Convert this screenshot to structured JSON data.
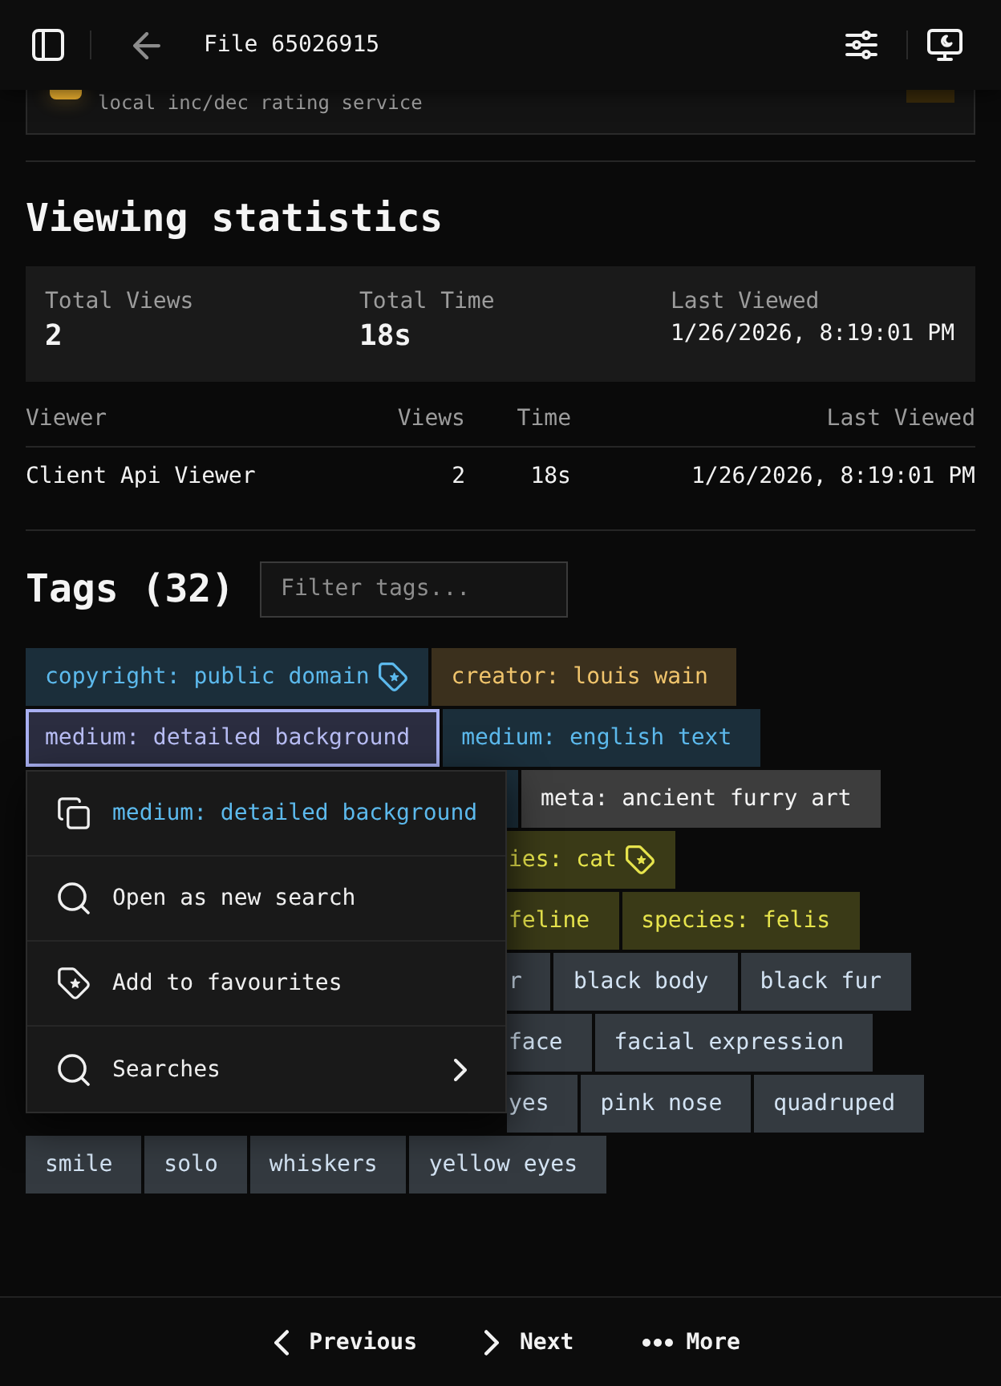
{
  "header": {
    "title": "File 65026915"
  },
  "rating_card": {
    "text": "local inc/dec rating service"
  },
  "viewing_statistics": {
    "title": "Viewing statistics",
    "summary": [
      {
        "label": "Total Views",
        "value": "2",
        "kind": "number"
      },
      {
        "label": "Total Time",
        "value": "18s",
        "kind": "number"
      },
      {
        "label": "Last Viewed",
        "value": "1/26/2026, 8:19:01 PM",
        "kind": "text"
      }
    ],
    "table": {
      "columns": [
        "Viewer",
        "Views",
        "Time",
        "Last Viewed"
      ],
      "rows": [
        [
          "Client Api Viewer",
          "2",
          "18s",
          "1/26/2026, 8:19:01 PM"
        ]
      ]
    }
  },
  "tags": {
    "title": "Tags (32)",
    "filter": {
      "placeholder": "Filter tags..."
    },
    "top": [
      {
        "text": "copyright: public domain",
        "kind": "copyright",
        "selected": false,
        "favourite": true
      },
      {
        "text": "creator: louis wain",
        "kind": "creator",
        "selected": false,
        "favourite": false
      },
      {
        "text": "medium: detailed background",
        "kind": "medium",
        "selected": true,
        "favourite": false
      },
      {
        "text": "medium: english text",
        "kind": "medium",
        "selected": false,
        "favourite": false
      }
    ],
    "context_menu": {
      "items": [
        {
          "kind": "copy",
          "label": "medium: detailed background",
          "submenu": false
        },
        {
          "kind": "search",
          "label": "Open as new search",
          "submenu": false
        },
        {
          "kind": "favourite",
          "label": "Add to favourites",
          "submenu": false
        },
        {
          "kind": "search",
          "label": "Searches",
          "submenu": true
        }
      ]
    },
    "beside_menu": [
      [
        {
          "kind": "medium",
          "selected": false,
          "favourite": false
        },
        {
          "text": "meta: ancient furry art",
          "kind": "meta",
          "selected": false,
          "favourite": false
        }
      ],
      [
        {
          "text": "ies: cat",
          "kind": "species",
          "selected": false,
          "favourite": true
        }
      ],
      [
        {
          "text": "feline",
          "kind": "species",
          "selected": false,
          "favourite": false
        },
        {
          "text": "species: felis",
          "kind": "species",
          "selected": false,
          "favourite": false
        }
      ],
      [
        {
          "text": "r",
          "kind": "general",
          "selected": false,
          "favourite": false
        },
        {
          "text": "black body",
          "kind": "general",
          "selected": false,
          "favourite": false
        },
        {
          "text": "black fur",
          "kind": "general",
          "selected": false,
          "favourite": false
        }
      ],
      [
        {
          "text": "face",
          "kind": "general",
          "selected": false,
          "favourite": false
        },
        {
          "text": "facial expression",
          "kind": "general",
          "selected": false,
          "favourite": false
        }
      ],
      [
        {
          "text": "yes",
          "kind": "general",
          "selected": false,
          "favourite": false
        },
        {
          "text": "pink nose",
          "kind": "general",
          "selected": false,
          "favourite": false
        },
        {
          "text": "quadruped",
          "kind": "general",
          "selected": false,
          "favourite": false
        }
      ]
    ],
    "bottom": [
      {
        "text": "smile",
        "kind": "general",
        "selected": false,
        "favourite": false
      },
      {
        "text": "solo",
        "kind": "general",
        "selected": false,
        "favourite": false
      },
      {
        "text": "whiskers",
        "kind": "general",
        "selected": false,
        "favourite": false
      },
      {
        "text": "yellow eyes",
        "kind": "general",
        "selected": false,
        "favourite": false
      }
    ]
  },
  "bottom_nav": [
    {
      "label": "Previous",
      "kind": "previous"
    },
    {
      "label": "Next",
      "kind": "next"
    },
    {
      "label": "More",
      "kind": "more"
    }
  ]
}
